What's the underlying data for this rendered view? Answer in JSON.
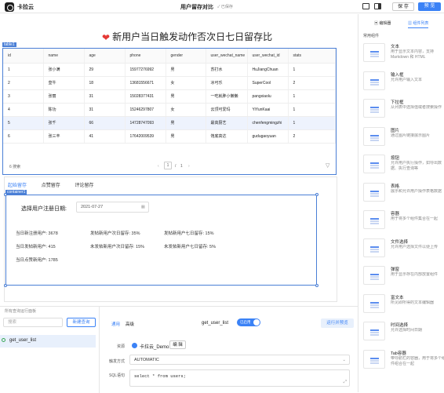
{
  "topbar": {
    "app_name": "卡拉云",
    "doc_title": "用户留存对比",
    "saved": "已保存",
    "save": "保 存",
    "preview": "预 览"
  },
  "heading": "新用户当日触发动作否次日七日留存比",
  "table": {
    "tag": "table1",
    "columns": [
      "id",
      "name",
      "age",
      "phone",
      "gender",
      "user_wechat_name",
      "user_wechat_id",
      "stats"
    ],
    "rows": [
      [
        "1",
        "张小满",
        "29",
        "15977276992",
        "男",
        "苏打水",
        "HuJiangChuan",
        "1"
      ],
      [
        "2",
        "皇牛",
        "18",
        "13681556671",
        "女",
        "冰可乐",
        "SuperCool",
        "2"
      ],
      [
        "3",
        "张丽",
        "31",
        "15028377431",
        "男",
        "一吃就胖小懒懒",
        "pangxiaolu",
        "1"
      ],
      [
        "4",
        "陈功",
        "31",
        "15246297807",
        "女",
        "云顶可爱玛",
        "YiYunKaai",
        "1"
      ],
      [
        "5",
        "张千",
        "66",
        "14728747093",
        "男",
        "最高厨艺",
        "chenfengmingzhi",
        "1"
      ],
      [
        "6",
        "张三丰",
        "41",
        "17642009539",
        "男",
        "饱底高达",
        "gudugaoyuan",
        "2"
      ]
    ],
    "total": "6 搜索",
    "page": "1",
    "sep": "/",
    "pages": "1"
  },
  "tabs": [
    "起始留存",
    "点赞留存",
    "评论留存"
  ],
  "container": {
    "tag": "container1",
    "date_label": "选择用户注册日期:",
    "date_value": "2021-07-27",
    "stats": [
      "当日新注册用户: 3678",
      "发帖新用户次日留存: 35%",
      "发帖新用户七日留存: 15%",
      "当日发帖新用户: 415",
      "未发帖新用户次日留存: 15%",
      "未发帖新用户七日留存: 5%",
      "当日点赞新用户: 1785"
    ]
  },
  "bottom": {
    "header": "所有查询运行面板",
    "search_placeholder": "搜索",
    "new_query": "新建查询",
    "query_name": "get_user_list",
    "tab_general": "通用",
    "tab_advanced": "高级",
    "title": "get_user_list",
    "toggle": "已启用",
    "run": "运行并预览",
    "resource_label": "资源",
    "resource": "卡拉云_Demo",
    "edit": "编 辑",
    "trigger_label": "触发方式",
    "trigger": "AUTOMATIC",
    "sql_label": "SQL语句",
    "sql": "select * from users;"
  },
  "right": {
    "tab_editor": "编辑器",
    "tab_components": "组件列表",
    "section": "常用组件",
    "components": [
      {
        "t": "文本",
        "d": "用于显示文本内容，支持 Markdown 和 HTML"
      },
      {
        "t": "输入框",
        "d": "允许用户输入文本"
      },
      {
        "t": "下拉框",
        "d": "从列表中选择值或者搜索操作"
      },
      {
        "t": "图片",
        "d": "通过图片链接展示图片"
      },
      {
        "t": "按钮",
        "d": "允许用户执行操作，如导出数据、执行查询等"
      },
      {
        "t": "表格",
        "d": "展示和允许用户操作表格数据"
      },
      {
        "t": "容器",
        "d": "用于将多个组件集合在一起"
      },
      {
        "t": "文件选择",
        "d": "允许用户选择文件以便上传"
      },
      {
        "t": "弹窗",
        "d": "用于显示存在内部放置组件"
      },
      {
        "t": "富文本",
        "d": "所见即所得的文本编辑器"
      },
      {
        "t": "时间选择",
        "d": "允许选择时间日期"
      },
      {
        "t": "Tab容器",
        "d": "带导航栏的容器，用于将多个组件组合在一起"
      }
    ]
  }
}
